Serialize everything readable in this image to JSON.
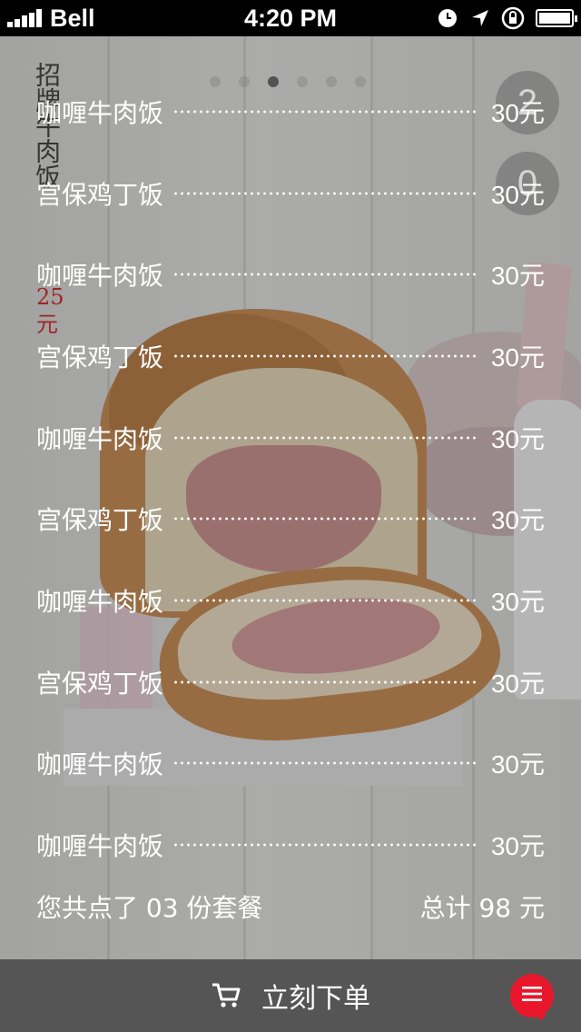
{
  "status_bar": {
    "carrier": "Bell",
    "time": "4:20 PM"
  },
  "vertical_title": {
    "text": "招牌牛肉饭",
    "price_number": "25",
    "price_unit": "元"
  },
  "pager": {
    "count": 6,
    "active_index": 2
  },
  "side_buttons": {
    "first": "2",
    "second": "0"
  },
  "order_items": [
    {
      "name": "咖喱牛肉饭",
      "price": "30元"
    },
    {
      "name": "宫保鸡丁饭",
      "price": "30元"
    },
    {
      "name": "咖喱牛肉饭",
      "price": "30元"
    },
    {
      "name": "宫保鸡丁饭",
      "price": "30元"
    },
    {
      "name": "咖喱牛肉饭",
      "price": "30元"
    },
    {
      "name": "宫保鸡丁饭",
      "price": "30元"
    },
    {
      "name": "咖喱牛肉饭",
      "price": "30元"
    },
    {
      "name": "宫保鸡丁饭",
      "price": "30元"
    },
    {
      "name": "咖喱牛肉饭",
      "price": "30元"
    },
    {
      "name": "咖喱牛肉饭",
      "price": "30元"
    }
  ],
  "summary": {
    "count_text": "您共点了 03 份套餐",
    "total_text": "总计 98 元"
  },
  "bottom_bar": {
    "order_label": "立刻下单",
    "cart_icon": "cart-icon",
    "menu_icon": "menu-icon"
  },
  "colors": {
    "accent": "#e8172b",
    "bottom_bar": "#555555",
    "price_red": "#a01818"
  }
}
